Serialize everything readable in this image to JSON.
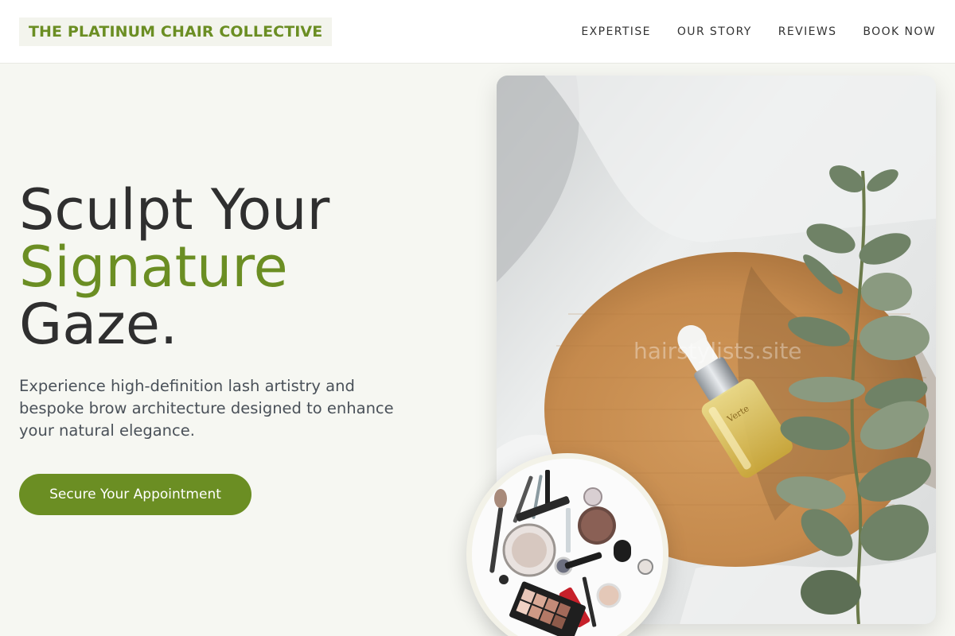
{
  "header": {
    "logo": "THE PLATINUM CHAIR COLLECTIVE",
    "nav": [
      "EXPERTISE",
      "OUR STORY",
      "REVIEWS",
      "BOOK NOW"
    ]
  },
  "hero": {
    "title_line1": "Sculpt Your",
    "title_accent": "Signature",
    "title_line3": "Gaze.",
    "subtitle": "Experience high-definition lash artistry and bespoke brow architecture designed to enhance your natural elegance.",
    "cta": "Secure Your Appointment"
  },
  "photo": {
    "watermark": "hairstylists.site",
    "bottle_label": "Verte"
  },
  "colors": {
    "accent": "#6b8e23",
    "background": "#f6f7f2",
    "text": "#2f2f2f"
  }
}
